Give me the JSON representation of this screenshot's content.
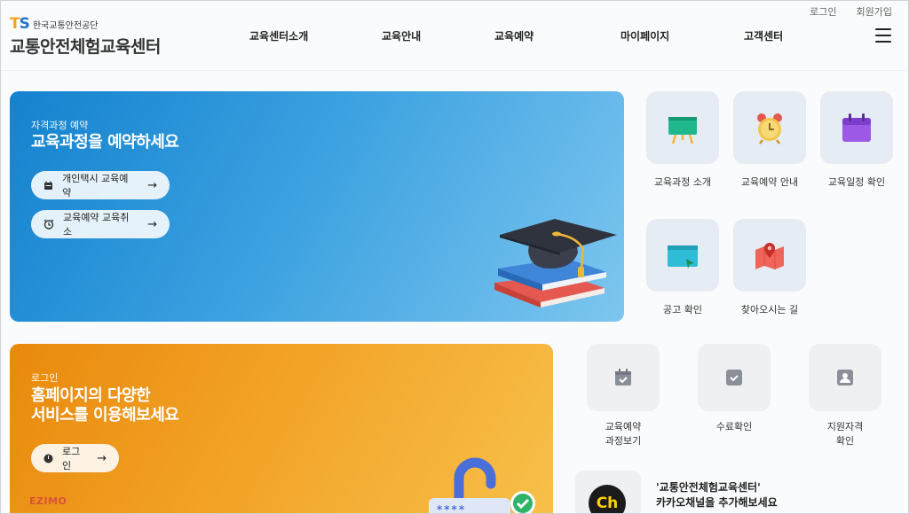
{
  "util": {
    "login": "로그인",
    "signup": "회원가입"
  },
  "logo": {
    "ts": [
      "T",
      "S"
    ],
    "org": "한국교통안전공단",
    "name": "교통안전체험교육센터"
  },
  "gnb": [
    "교육센터소개",
    "교육안내",
    "교육예약",
    "마이페이지",
    "고객센터"
  ],
  "hero_blue": {
    "kicker": "자격과정 예약",
    "title": "교육과정을 예약하세요",
    "buttons": [
      {
        "label": "개인택시 교육예약",
        "icon": "calendar-icon"
      },
      {
        "label": "교육예약 교육취소",
        "icon": "alarm-icon"
      }
    ]
  },
  "tiles_top": [
    {
      "label": "교육과정 소개",
      "icon": "blackboard-icon"
    },
    {
      "label": "교육예약 안내",
      "icon": "alarm-clock-icon"
    },
    {
      "label": "교육일정 확인",
      "icon": "calendar-icon"
    },
    {
      "label": "공고 확인",
      "icon": "monitor-icon"
    },
    {
      "label": "찾아오시는 길",
      "icon": "map-pin-icon"
    }
  ],
  "hero_orange": {
    "kicker": "로그인",
    "title_lines": [
      "홈페이지의 다양한",
      "서비스를 이용해보세요"
    ],
    "button": {
      "label": "로그인",
      "icon": "power-icon"
    },
    "password_dots": "****"
  },
  "tiles_bottom": [
    {
      "lines": [
        "교육예약",
        "과정보기"
      ],
      "icon": "calendar-check-icon"
    },
    {
      "lines": [
        "수료확인"
      ],
      "icon": "check-box-icon"
    },
    {
      "lines": [
        "지원자격",
        "확인"
      ],
      "icon": "user-card-icon"
    }
  ],
  "kakao": {
    "badge": "Ch",
    "lines": [
      "'교통안전체험교육센터'",
      "카카오채널을 추가해보세요"
    ]
  },
  "brand": "EZIMO",
  "colors": {
    "blue": "#1482cf",
    "orange": "#e9890c",
    "accent_green": "#1fb88d"
  }
}
